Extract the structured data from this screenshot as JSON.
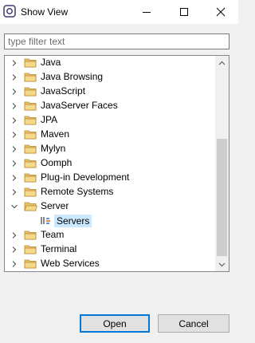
{
  "window": {
    "title": "Show View",
    "minimize_icon": "minimize-icon",
    "maximize_icon": "maximize-icon",
    "close_icon": "close-icon"
  },
  "filter": {
    "placeholder": "type filter text",
    "value": ""
  },
  "tree": {
    "items": [
      {
        "label": "Java",
        "expanded": false,
        "icon": "folder-icon"
      },
      {
        "label": "Java Browsing",
        "expanded": false,
        "icon": "folder-icon"
      },
      {
        "label": "JavaScript",
        "expanded": false,
        "icon": "folder-icon"
      },
      {
        "label": "JavaServer Faces",
        "expanded": false,
        "icon": "folder-icon"
      },
      {
        "label": "JPA",
        "expanded": false,
        "icon": "folder-icon"
      },
      {
        "label": "Maven",
        "expanded": false,
        "icon": "folder-icon"
      },
      {
        "label": "Mylyn",
        "expanded": false,
        "icon": "folder-icon"
      },
      {
        "label": "Oomph",
        "expanded": false,
        "icon": "folder-icon"
      },
      {
        "label": "Plug-in Development",
        "expanded": false,
        "icon": "folder-icon"
      },
      {
        "label": "Remote Systems",
        "expanded": false,
        "icon": "folder-icon"
      },
      {
        "label": "Server",
        "expanded": true,
        "icon": "folder-open-icon"
      },
      {
        "label": "Servers",
        "child": true,
        "selected": true,
        "icon": "servers-view-icon"
      },
      {
        "label": "Team",
        "expanded": false,
        "icon": "folder-icon"
      },
      {
        "label": "Terminal",
        "expanded": false,
        "icon": "folder-icon"
      },
      {
        "label": "Web Services",
        "expanded": false,
        "icon": "folder-icon"
      }
    ]
  },
  "buttons": {
    "open": "Open",
    "cancel": "Cancel"
  },
  "colors": {
    "selection": "#cce8ff",
    "default_button_border": "#0078d7",
    "folder": "#dcb35c"
  }
}
